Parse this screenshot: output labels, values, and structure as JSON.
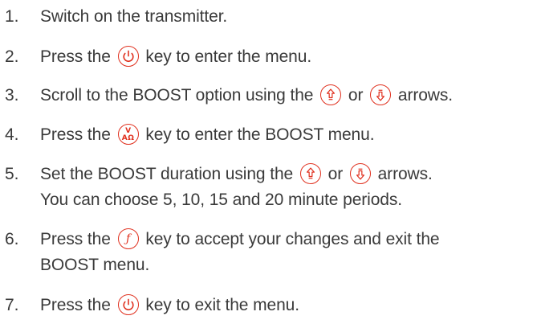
{
  "steps": [
    {
      "num": "1.",
      "parts": [
        "Switch on the transmitter."
      ]
    },
    {
      "num": "2.",
      "parts": [
        "Press the",
        "key to enter the menu."
      ]
    },
    {
      "num": "3.",
      "parts": [
        "Scroll to the BOOST option using the",
        "or",
        "arrows."
      ]
    },
    {
      "num": "4.",
      "parts": [
        "Press the",
        "key to enter the BOOST menu."
      ]
    },
    {
      "num": "5.",
      "parts": [
        "Set the BOOST duration using the",
        "or",
        "arrows."
      ],
      "line2": "You can choose 5, 10, 15 and 20 minute periods."
    },
    {
      "num": "6.",
      "parts": [
        "Press the",
        "key to accept your changes and exit the"
      ],
      "line2": "BOOST menu."
    },
    {
      "num": "7.",
      "parts": [
        "Press the",
        "key to exit the menu."
      ]
    }
  ],
  "icons": {
    "power": "power-icon",
    "up": "up-arrow-icon",
    "down": "down-arrow-icon",
    "ok": "v-a-omega-icon",
    "function": "function-icon"
  },
  "colors": {
    "text": "#3a3a3a",
    "icon": "#e0301e"
  }
}
